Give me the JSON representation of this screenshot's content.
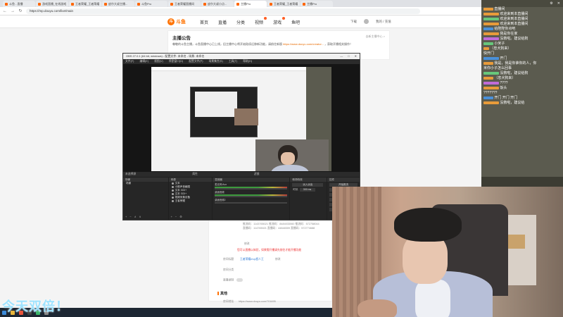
{
  "browser": {
    "tabs": [
      "斗鱼 - 直播",
      "游戏直播_在线游戏直播",
      "王者荣耀_王者荣耀直播",
      "皮尔大叔主播...",
      "斗鱼Pro",
      "王者荣耀直播间",
      "皮尔大叔小点...",
      "主播Pro",
      "王者荣耀_王者荣耀直播",
      "主播Pro"
    ],
    "url": "https://mp.douyu.com/live/main",
    "win_controls": [
      "—",
      "□",
      "✕"
    ]
  },
  "site": {
    "logo_mark": "斗",
    "logo_text": "斗鱼",
    "nav": [
      "首页",
      "直播",
      "分类",
      "视频",
      "游戏",
      "鱼吧"
    ],
    "header_right": [
      "下载",
      "我的 / 充值"
    ]
  },
  "announcement": {
    "title": "主播公告",
    "body": "尊敬的斗鱼主播，斗鱼直播中心已上线，旧主播中心将开始陆续迁移新功能，请前往新版",
    "link": "https://www.douyu.com/creator...",
    "body_end": "，获取开播相关操作！",
    "more": "去新主播中心 >"
  },
  "content": {
    "rows": [
      "推流码：1143765021 推流码：8484033060 推流码：572758044",
      "直播码：114765021 直播码：44848309 直播码：572774688"
    ],
    "status": "修改",
    "warning": "您可以直播以体验，如果需开播请先前往才能开播功能",
    "room_label": "房间标题",
    "room_value": "王者荣耀mvp超人王",
    "modify": "修改",
    "category_label": "房间分类",
    "record_label": "直播录制",
    "section_title": "其他",
    "addr_label": "房间地址",
    "addr_value": "https://www.douyu.com/701695"
  },
  "obs": {
    "title": "OBS 27.0.1 (64 bit, windows) - 配置文件: 未命名 - 场景: 未命名",
    "menu": [
      "文件(F)",
      "编辑(E)",
      "视图(V)",
      "停靠窗口(D)",
      "配置文件(P)",
      "场景集合(S)",
      "工具(T)",
      "帮助(H)"
    ],
    "scene_bar": [
      "未选择源",
      "属性",
      "滤镜"
    ],
    "docks": {
      "scenes": {
        "title": "场景",
        "items": [
          "场景"
        ]
      },
      "sources": {
        "title": "来源",
        "items": [
          "文本",
          "小鹅声音截图",
          "文本 GDI+",
          "文本 GDI+",
          "视频采集设备",
          "王者荣耀"
        ]
      },
      "mixer": {
        "title": "混音器",
        "tracks": [
          "麦克风/Aux",
          "桌面音频",
          "桌面音频2"
        ]
      },
      "transitions": {
        "title": "转场特效",
        "type": "淡入淡出",
        "duration_label": "时长",
        "duration": "300 ms"
      },
      "controls": {
        "title": "控件",
        "buttons": [
          "开始推流",
          "开始录制",
          "启动虚拟摄像机",
          "工作室模式",
          "设置",
          "退出"
        ]
      }
    }
  },
  "chat": {
    "top_buttons": [
      "⚙",
      "✕"
    ],
    "messages": [
      "直播间",
      "欢迎来到本直播间",
      "欢迎来到本直播间",
      "欢迎来到本直播间",
      "给陛陛你点吧",
      "我是你在家",
      "没救啦。建议给狗",
      "小米子",
      "（忠犬狗来）",
      "快开门",
      "开门",
      "我是，我是你谁你的人，你",
      "米你小子怎么回事",
      "没救啦，建议给狗",
      "（忠犬狗来）",
      "????",
      "饭头",
      "??????? ",
      "开门 开门 开门",
      "没救啦，建议给"
    ]
  },
  "overlay": {
    "text": "今天双倍！"
  }
}
